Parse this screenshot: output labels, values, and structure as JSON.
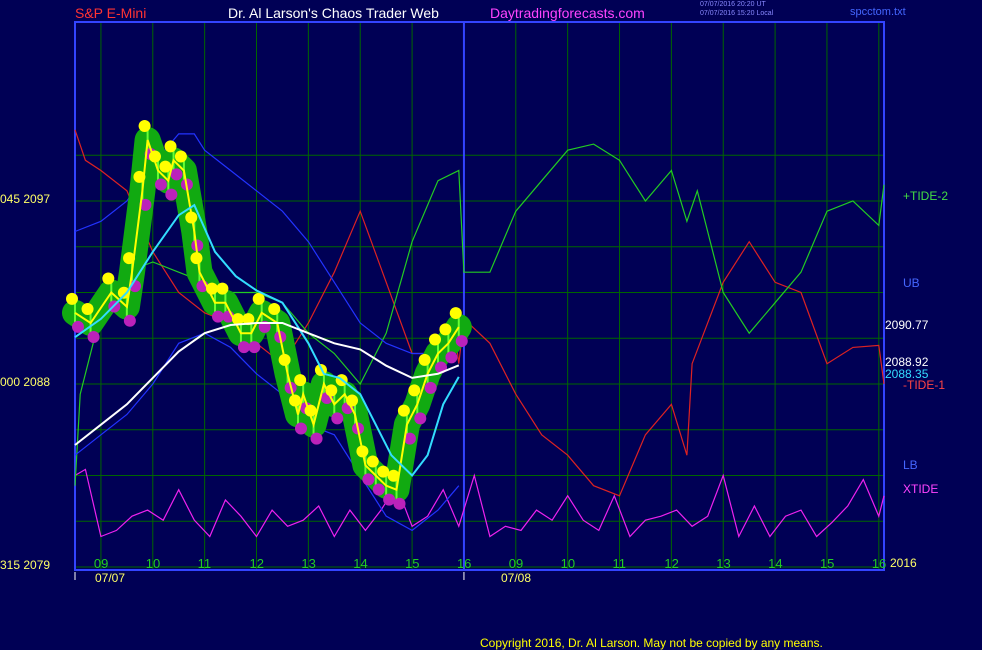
{
  "header": {
    "symbol": "S&P E-Mini",
    "title": "Dr. Al Larson's Chaos Trader Web",
    "site": "Daytradingforecasts.com",
    "stamp_ut": "07/07/2016 20:20 UT",
    "stamp_local": "07/07/2016 15:20 Local",
    "file": "spcctom.txt"
  },
  "footer": {
    "copyright": "Copyright 2016, Dr. Al Larson. May not be copied by any means."
  },
  "colors": {
    "background": "#000055",
    "grid": "#006600",
    "axis": "#3344ff",
    "price": "#ffff00",
    "ema_fast": "#33ddff",
    "ema_slow": "#ffffff",
    "band": "#2233ff",
    "tide1": "#dd2222",
    "tide2": "#22cc22",
    "xtide": "#ee22ee"
  },
  "chart_data": {
    "type": "line",
    "title": "S&P E-Mini",
    "y_left_ticks": [
      "045 2097",
      "000 2088",
      "315 2079"
    ],
    "ylim": [
      2079,
      2101
    ],
    "x_tick_labels": [
      "09",
      "10",
      "11",
      "12",
      "13",
      "14",
      "15",
      "16",
      "09",
      "10",
      "11",
      "12",
      "13",
      "14",
      "15",
      "16"
    ],
    "date_labels": [
      "07/07",
      "07/08"
    ],
    "year_label": "2016",
    "right_labels": {
      "tide2": "+TIDE-2",
      "ub": "UB",
      "price_last": "2090.77",
      "slow_last": "2088.92",
      "fast_last": "2088.35",
      "tide1": "-TIDE-1",
      "lb": "LB",
      "xtide": "XTIDE"
    },
    "series": [
      {
        "name": "S&P E-Mini",
        "x": [
          8.5,
          8.8,
          9.2,
          9.5,
          9.6,
          9.8,
          9.9,
          10.1,
          10.3,
          10.4,
          10.6,
          10.8,
          10.9,
          11.2,
          11.4,
          11.7,
          11.9,
          12.1,
          12.4,
          12.6,
          12.8,
          12.9,
          13.1,
          13.3,
          13.5,
          13.7,
          13.9,
          14.1,
          14.3,
          14.5,
          14.7,
          14.9,
          15.1,
          15.3,
          15.5,
          15.7,
          15.9
        ],
        "y": [
          2091.5,
          2091.0,
          2092.5,
          2091.8,
          2093.5,
          2097.5,
          2100.0,
          2098.5,
          2098.0,
          2099.0,
          2098.5,
          2095.5,
          2093.5,
          2092.0,
          2092.0,
          2090.5,
          2090.5,
          2091.5,
          2091.0,
          2088.5,
          2086.5,
          2087.5,
          2086.0,
          2088.0,
          2087.0,
          2087.5,
          2086.5,
          2084.0,
          2083.5,
          2083.0,
          2082.8,
          2086.0,
          2087.0,
          2088.5,
          2089.5,
          2090.0,
          2090.8
        ]
      },
      {
        "name": "EMA fast",
        "x": [
          8.5,
          9.0,
          9.5,
          10.0,
          10.5,
          10.8,
          11.2,
          11.6,
          12.0,
          12.5,
          13.0,
          13.3,
          13.6,
          14.0,
          14.3,
          14.6,
          15.0,
          15.3,
          15.6,
          15.9
        ],
        "y": [
          2090.3,
          2091.2,
          2092.5,
          2094.5,
          2096.3,
          2096.8,
          2094.5,
          2093.3,
          2092.6,
          2092.0,
          2090.0,
          2088.5,
          2088.3,
          2087.5,
          2086.0,
          2084.5,
          2083.5,
          2084.5,
          2087.0,
          2088.35
        ]
      },
      {
        "name": "EMA slow",
        "x": [
          8.5,
          9.0,
          9.5,
          10.0,
          10.5,
          11.0,
          11.5,
          12.0,
          12.5,
          13.0,
          13.5,
          14.0,
          14.5,
          15.0,
          15.5,
          15.9
        ],
        "y": [
          2085.0,
          2086.0,
          2087.0,
          2088.3,
          2089.6,
          2090.5,
          2090.9,
          2091.0,
          2091.0,
          2090.5,
          2090.0,
          2089.7,
          2088.9,
          2088.3,
          2088.5,
          2088.92
        ]
      },
      {
        "name": "UB",
        "x": [
          8.5,
          9.0,
          9.5,
          10.0,
          10.5,
          10.8,
          11.0,
          11.5,
          12.0,
          12.5,
          13.0,
          13.5,
          14.0,
          14.5,
          15.0,
          15.3,
          15.6,
          15.9
        ],
        "y": [
          2095.5,
          2096.0,
          2097.0,
          2098.8,
          2100.3,
          2100.3,
          2099.5,
          2098.5,
          2097.5,
          2096.5,
          2095.0,
          2093.0,
          2091.0,
          2090.0,
          2089.5,
          2089.5,
          2090.5,
          2091.5
        ]
      },
      {
        "name": "LB",
        "x": [
          8.5,
          9.0,
          9.5,
          10.0,
          10.5,
          11.0,
          11.5,
          12.0,
          12.5,
          13.0,
          13.5,
          14.0,
          14.5,
          15.0,
          15.5,
          15.9
        ],
        "y": [
          2084.5,
          2085.5,
          2086.5,
          2088.0,
          2090.0,
          2090.5,
          2089.8,
          2088.5,
          2087.5,
          2086.0,
          2085.5,
          2083.5,
          2081.5,
          2080.8,
          2081.8,
          2083.0
        ]
      },
      {
        "name": "-TIDE-1",
        "x": [
          8.5,
          8.7,
          9.0,
          9.5,
          10.0,
          10.5,
          11.0,
          11.5,
          12.0,
          12.5,
          13.0,
          13.5,
          14.0,
          14.5,
          15.0,
          15.3,
          15.6,
          15.8,
          15.9,
          16.0,
          16.5,
          17.0,
          17.5,
          18.0,
          18.5,
          19.0,
          19.5,
          20.0,
          20.3,
          20.4,
          21.0,
          21.5,
          22.0,
          22.5,
          23.0,
          23.5,
          24.0,
          24.1
        ],
        "y": [
          2100.5,
          2099.0,
          2098.5,
          2097.5,
          2094.5,
          2092.5,
          2091.5,
          2091.0,
          2090.0,
          2089.0,
          2091.0,
          2093.5,
          2096.5,
          2093.0,
          2089.5,
          2089.5,
          2090.5,
          2091.0,
          2089.0,
          2091.2,
          2090.0,
          2087.5,
          2085.5,
          2084.5,
          2083.0,
          2082.5,
          2085.5,
          2087.0,
          2084.5,
          2089.0,
          2093.0,
          2095.0,
          2093.0,
          2092.5,
          2089.0,
          2089.8,
          2089.9,
          2088.0
        ]
      },
      {
        "name": "+TIDE-2",
        "x": [
          8.5,
          8.6,
          9.0,
          9.5,
          10.0,
          10.5,
          11.0,
          11.5,
          12.0,
          12.5,
          13.0,
          13.5,
          14.0,
          14.5,
          15.0,
          15.5,
          15.9,
          16.0,
          16.5,
          17.0,
          17.5,
          18.0,
          18.5,
          19.0,
          19.5,
          20.0,
          20.3,
          20.5,
          21.0,
          21.5,
          22.0,
          22.5,
          23.0,
          23.5,
          24.0,
          24.1
        ],
        "y": [
          2083.0,
          2087.5,
          2091.5,
          2093.5,
          2094.0,
          2093.5,
          2093.0,
          2092.5,
          2092.5,
          2092.0,
          2090.5,
          2089.5,
          2088.0,
          2090.5,
          2095.0,
          2098.0,
          2098.5,
          2093.5,
          2093.5,
          2096.5,
          2098.0,
          2099.5,
          2099.8,
          2099.0,
          2097.0,
          2098.5,
          2096.0,
          2097.5,
          2092.5,
          2090.5,
          2092.0,
          2093.5,
          2096.5,
          2097.0,
          2095.8,
          2097.8
        ]
      },
      {
        "name": "XTIDE",
        "x": [
          8.5,
          8.7,
          9.0,
          9.3,
          9.6,
          9.9,
          10.2,
          10.5,
          10.8,
          11.1,
          11.4,
          11.7,
          12.0,
          12.3,
          12.6,
          12.9,
          13.2,
          13.5,
          13.8,
          14.1,
          14.4,
          14.7,
          15.0,
          15.3,
          15.6,
          15.9,
          16.2,
          16.5,
          16.8,
          17.1,
          17.4,
          17.7,
          18.0,
          18.3,
          18.6,
          18.9,
          19.2,
          19.5,
          19.8,
          20.1,
          20.4,
          20.7,
          21.0,
          21.3,
          21.6,
          21.9,
          22.2,
          22.5,
          22.8,
          23.1,
          23.4,
          23.7,
          24.0,
          24.1
        ],
        "y": [
          2083.5,
          2083.8,
          2080.5,
          2080.8,
          2081.5,
          2081.8,
          2081.3,
          2082.8,
          2081.3,
          2080.5,
          2082.3,
          2081.5,
          2080.5,
          2081.8,
          2081.0,
          2081.3,
          2082.0,
          2080.5,
          2081.8,
          2080.8,
          2081.8,
          2083.0,
          2081.0,
          2081.5,
          2082.8,
          2081.0,
          2083.5,
          2080.5,
          2081.0,
          2080.8,
          2081.8,
          2081.3,
          2082.5,
          2081.3,
          2080.8,
          2082.5,
          2080.5,
          2081.3,
          2081.5,
          2081.8,
          2081.0,
          2081.5,
          2083.5,
          2080.5,
          2082.0,
          2080.5,
          2081.5,
          2081.8,
          2080.5,
          2081.2,
          2082.0,
          2083.3,
          2081.5,
          2082.5
        ]
      }
    ]
  }
}
